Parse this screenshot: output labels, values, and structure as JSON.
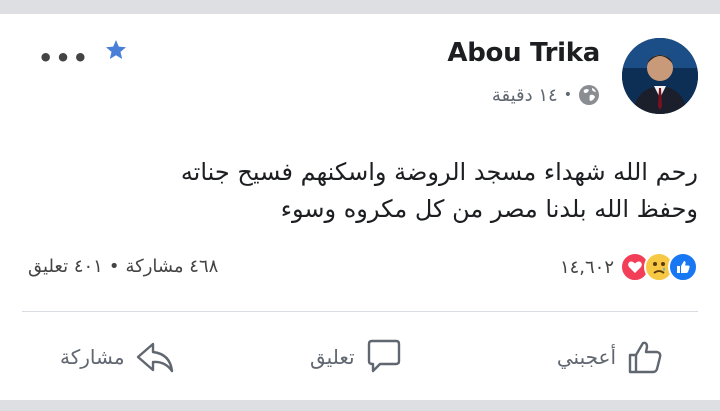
{
  "post": {
    "author": "Abou Trika",
    "time": "١٤ دقيقة",
    "separator": "•",
    "text_line1": "رحم الله شهداء مسجد الروضة واسكنهم فسيح جناته",
    "text_line2": "وحفظ الله بلدنا مصر من كل مكروه وسوء"
  },
  "stats": {
    "reaction_count": "١٤,٦٠٢",
    "comments": "٤٠١ تعليق",
    "shares": "٤٦٨ مشاركة",
    "separator": "•"
  },
  "actions": {
    "like": "أعجبني",
    "comment": "تعليق",
    "share": "مشاركة"
  },
  "icons": {
    "more": "more-options-icon",
    "star": "star-icon",
    "globe": "globe-icon",
    "like_reaction": "like-reaction-icon",
    "sad_reaction": "sad-reaction-icon",
    "love_reaction": "love-reaction-icon",
    "like_action": "thumbs-up-icon",
    "comment_action": "comment-bubble-icon",
    "share_action": "share-arrow-icon"
  },
  "colors": {
    "brand_blue": "#1877f2",
    "star_blue": "#4a7fd8",
    "love_red": "#f33e58",
    "sad_yellow": "#f7c843",
    "secondary_text": "#606770"
  }
}
